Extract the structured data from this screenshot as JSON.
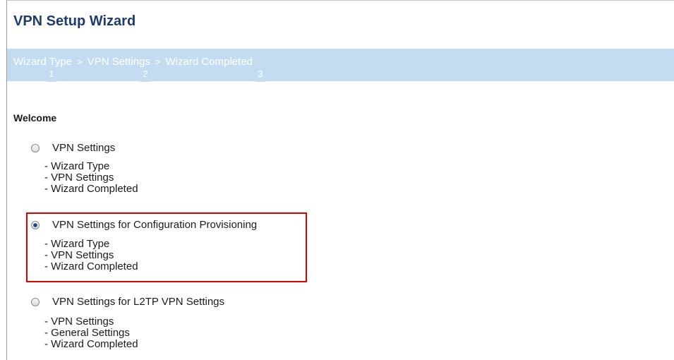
{
  "wizard": {
    "title": "VPN Setup Wizard",
    "steps": [
      {
        "label": "Wizard Type",
        "number": "1"
      },
      {
        "label": "VPN Settings",
        "number": "2"
      },
      {
        "label": "Wizard Completed",
        "number": "3"
      }
    ],
    "separator": ">"
  },
  "section": {
    "heading": "Welcome"
  },
  "options": [
    {
      "label": "VPN Settings",
      "selected": false,
      "details": [
        "- Wizard Type",
        "- VPN Settings",
        "- Wizard Completed"
      ]
    },
    {
      "label": "VPN Settings for Configuration Provisioning",
      "selected": true,
      "details": [
        "- Wizard Type",
        "- VPN Settings",
        "- Wizard Completed"
      ]
    },
    {
      "label": "VPN Settings for L2TP VPN Settings",
      "selected": false,
      "details": [
        "- VPN Settings",
        "- General Settings",
        "- Wizard Completed"
      ]
    }
  ],
  "colors": {
    "title": "#1f3b6e",
    "step_bar": "#c4dcf2",
    "highlight_border": "#e00000"
  }
}
